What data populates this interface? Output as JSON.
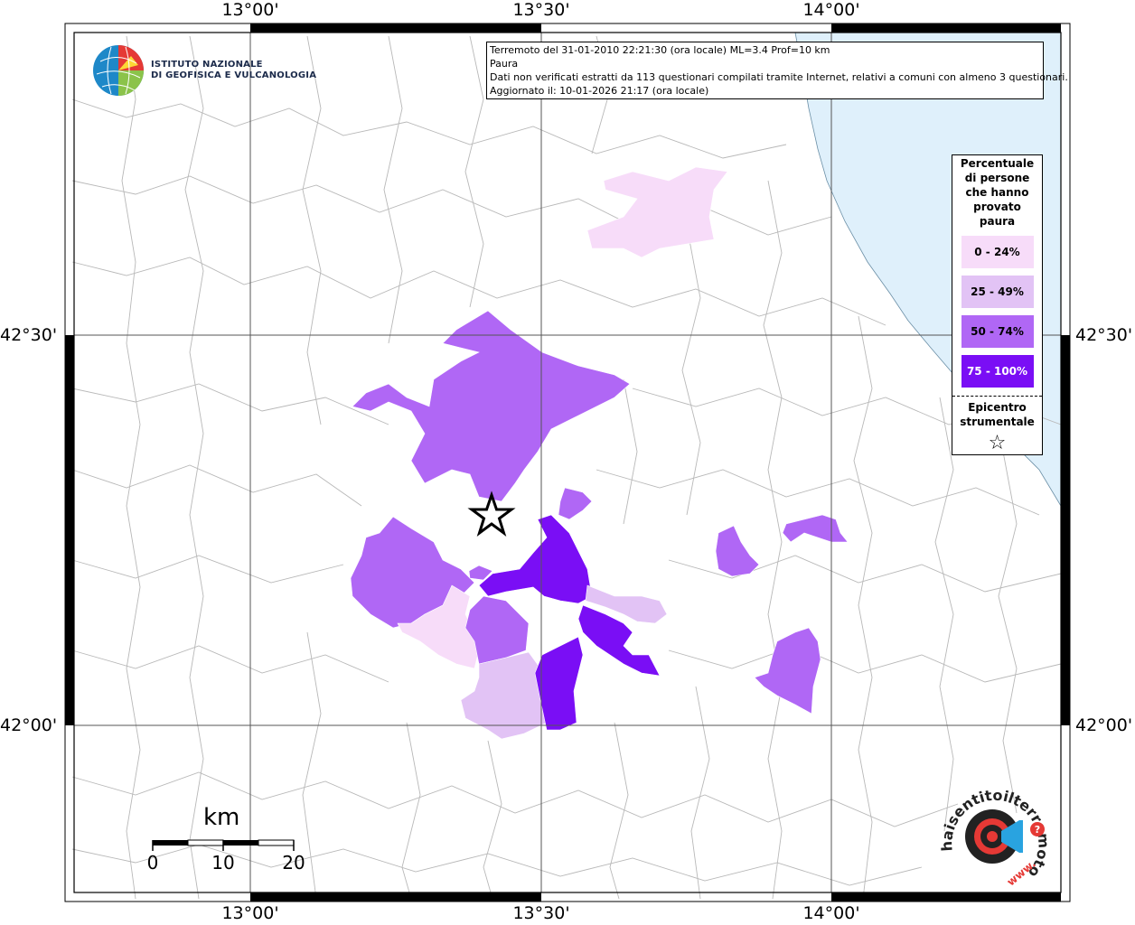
{
  "axes": {
    "lon_labels": [
      "13°00'",
      "13°30'",
      "14°00'"
    ],
    "lat_labels": [
      "42°30'",
      "42°00'"
    ]
  },
  "info": {
    "line1": "Terremoto del 31-01-2010 22:21:30 (ora locale) ML=3.4 Prof=10 km",
    "line2": "Paura",
    "line3": "Dati non verificati estratti da 113 questionari compilati tramite Internet, relativi a comuni con almeno 3 questionari.",
    "line4": "Aggiornato il: 10-01-2026 21:17 (ora locale)"
  },
  "legend": {
    "title_lines": [
      "Percentuale",
      "di persone",
      "che hanno",
      "provato",
      "paura"
    ],
    "classes": [
      {
        "label": "0 - 24%",
        "color": "#f7dcf9",
        "text_color": "#000000"
      },
      {
        "label": "25 - 49%",
        "color": "#e2c3f5",
        "text_color": "#000000"
      },
      {
        "label": "50 - 74%",
        "color": "#b067f5",
        "text_color": "#000000"
      },
      {
        "label": "75 - 100%",
        "color": "#7a0ef5",
        "text_color": "#ffffff"
      }
    ],
    "epicenter_lines": [
      "Epicentro",
      "strumentale"
    ],
    "epicenter_symbol": "☆"
  },
  "logo": {
    "line1": "ISTITUTO NAZIONALE",
    "line2": "DI GEOFISICA E VULCANOLOGIA"
  },
  "scalebar": {
    "unit": "km",
    "ticks": [
      "0",
      "10",
      "20"
    ]
  },
  "hsit": {
    "text": "haisentitoilterremoto.it",
    "prefix": "www.",
    "mark": "?"
  },
  "colors": {
    "sea": "#dff0fb",
    "border_lines": "#b8b8b8",
    "grid": "#555555",
    "class1": "#f7dcf9",
    "class2": "#e2c3f5",
    "class3": "#b067f5",
    "class4": "#7a0ef5"
  }
}
